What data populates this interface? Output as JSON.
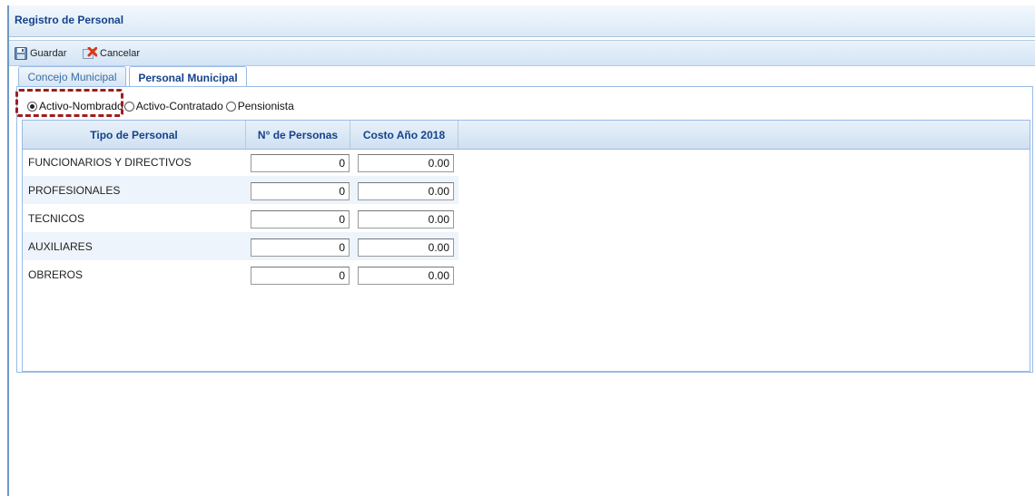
{
  "window": {
    "title": "Registro de Personal"
  },
  "toolbar": {
    "save_label": "Guardar",
    "cancel_label": "Cancelar",
    "save_icon": "floppy-disk-icon",
    "cancel_icon": "delete-x-icon"
  },
  "tabs": [
    {
      "label": "Concejo Municipal",
      "active": false
    },
    {
      "label": "Personal Municipal",
      "active": true
    }
  ],
  "radios": [
    {
      "label": "Activo-Nombrado",
      "checked": true
    },
    {
      "label": "Activo-Contratado",
      "checked": false
    },
    {
      "label": "Pensionista",
      "checked": false
    }
  ],
  "grid": {
    "columns": [
      "Tipo de Personal",
      "N° de Personas",
      "Costo Año 2018"
    ],
    "rows": [
      {
        "tipo": "FUNCIONARIOS Y DIRECTIVOS",
        "personas": "0",
        "costo": "0.00"
      },
      {
        "tipo": "PROFESIONALES",
        "personas": "0",
        "costo": "0.00"
      },
      {
        "tipo": "TECNICOS",
        "personas": "0",
        "costo": "0.00"
      },
      {
        "tipo": "AUXILIARES",
        "personas": "0",
        "costo": "0.00"
      },
      {
        "tipo": "OBREROS",
        "personas": "0",
        "costo": "0.00"
      }
    ]
  },
  "colors": {
    "title_text": "#15428b",
    "border": "#99bbe8",
    "highlight": "#a01d1d"
  }
}
